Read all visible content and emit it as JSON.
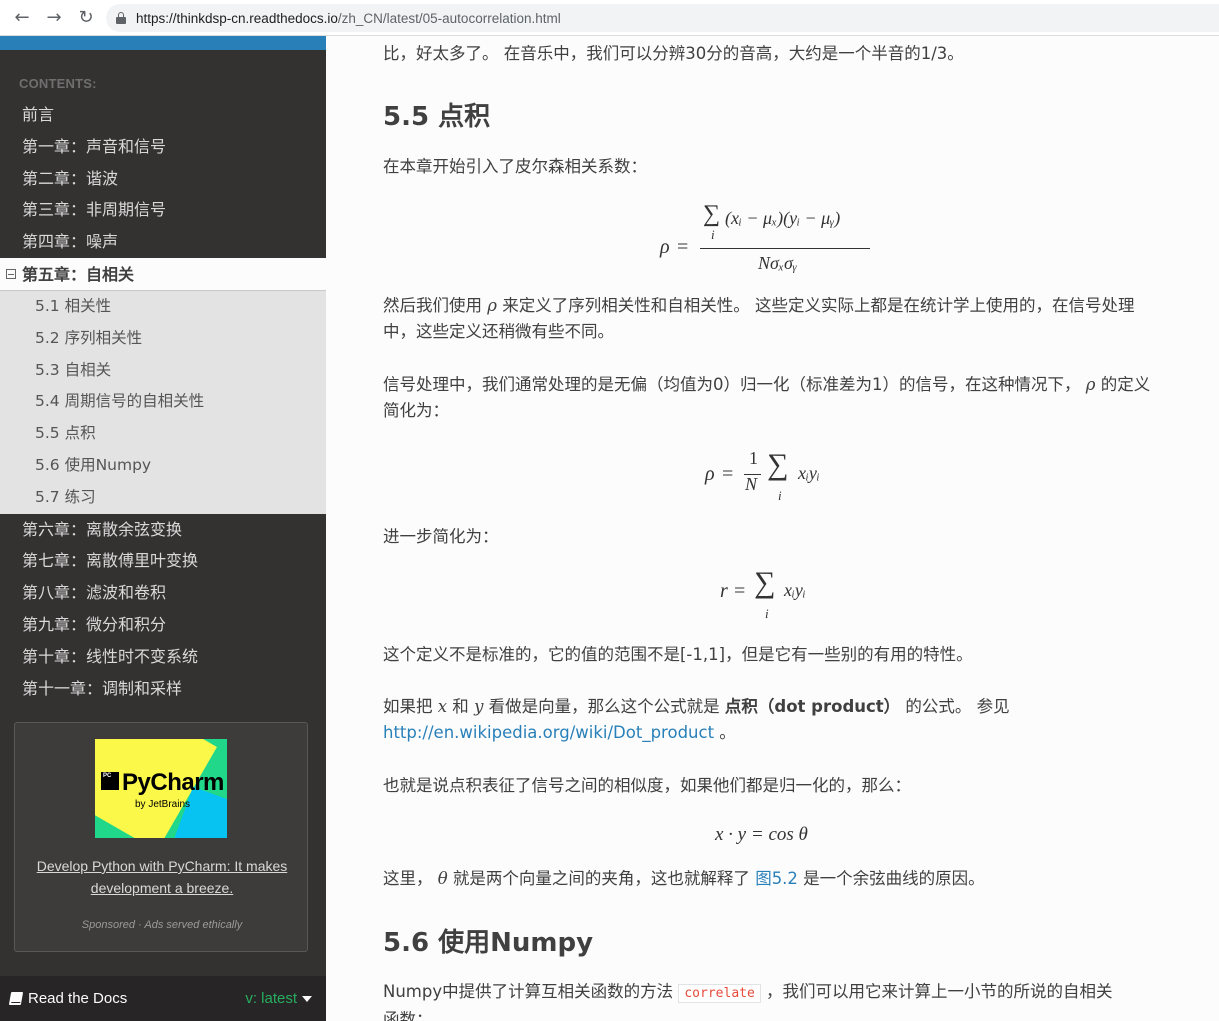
{
  "browser": {
    "url_host": "https://thinkdsp-cn.readthedocs.io",
    "url_path": "/zh_CN/latest/05-autocorrelation.html"
  },
  "sidebar": {
    "caption": "CONTENTS:",
    "items_before": [
      "前言",
      "第一章：声音和信号",
      "第二章：谐波",
      "第三章：非周期信号",
      "第四章：噪声"
    ],
    "current": "第五章：自相关",
    "subitems": [
      "5.1 相关性",
      "5.2 序列相关性",
      "5.3 自相关",
      "5.4 周期信号的自相关性",
      "5.5 点积",
      "5.6 使用Numpy",
      "5.7 练习"
    ],
    "items_after": [
      "第六章：离散余弦变换",
      "第七章：离散傅里叶变换",
      "第八章：滤波和卷积",
      "第九章：微分和积分",
      "第十章：线性时不变系统",
      "第十一章：调制和采样"
    ],
    "ad": {
      "logo_small": "PC",
      "logo_text": "PyCharm",
      "logo_sub": "by JetBrains",
      "link": "Develop Python with PyCharm: It makes development a breeze.",
      "note": "Sponsored · Ads served ethically"
    },
    "rtd": {
      "label": "Read the Docs",
      "version": "v: latest"
    }
  },
  "main": {
    "p0": "比，好太多了。 在音乐中，我们可以分辨30分的音高，大约是一个半音的1/3。",
    "h_55": "5.5 点积",
    "p1": "在本章开始引入了皮尔森相关系数：",
    "p2a": "然后我们使用 ",
    "p2_rho": "ρ",
    "p2b": " 来定义了序列相关性和自相关性。 这些定义实际上都是在统计学上使用的，在信号处理中，这些定义还稍微有些不同。",
    "p3a": "信号处理中，我们通常处理的是无偏（均值为0）归一化（标准差为1）的信号，在这种情况下， ",
    "p3_rho": "ρ",
    "p3b": " 的定义简化为：",
    "p4": "进一步简化为：",
    "p5": "这个定义不是标准的，它的值的范围不是[-1,1]，但是它有一些别的有用的特性。",
    "p6a": "如果把 ",
    "p6_x": "x",
    "p6b": " 和 ",
    "p6_y": "y",
    "p6c": " 看做是向量，那么这个公式就是 ",
    "p6_bold": "点积（dot product）",
    "p6d": " 的公式。 参见 ",
    "p6_link": "http://en.wikipedia.org/wiki/Dot_product",
    "p6e": " 。",
    "p7": "也就是说点积表征了信号之间的相似度，如果他们都是归一化的，那么：",
    "p8a": "这里， ",
    "p8_theta": "θ",
    "p8b": " 就是两个向量之间的夹角，这也就解释了 ",
    "p8_link": "图5.2",
    "p8c": " 是一个余弦曲线的原因。",
    "h_56": "5.6 使用Numpy",
    "p9a": "Numpy中提供了计算互相关函数的方法 ",
    "p9_code": "correlate",
    "p9b": " ，我们可以用它来计算上一小节的所说的自相关",
    "p9c": "函数："
  },
  "equations": {
    "eq1": {
      "lhs": "ρ",
      "eq": "=",
      "num_sigma": "∑",
      "num_sub": "i",
      "numerator": "(xᵢ − μₓ)(yᵢ − μᵧ)",
      "denominator": "Nσₓσᵧ"
    },
    "eq2": {
      "lhs": "ρ",
      "eq": "=",
      "frac_num": "1",
      "frac_den": "N",
      "sigma": "∑",
      "sub": "i",
      "term": "xᵢyᵢ"
    },
    "eq3": {
      "lhs": "r",
      "eq": "=",
      "sigma": "∑",
      "sub": "i",
      "term": "xᵢyᵢ"
    },
    "eq4": {
      "text": "x · y = cos θ"
    }
  },
  "colors": {
    "sidebar": "#343131",
    "accent": "#2980b9",
    "link": "#2980b9",
    "version": "#27ae60"
  }
}
